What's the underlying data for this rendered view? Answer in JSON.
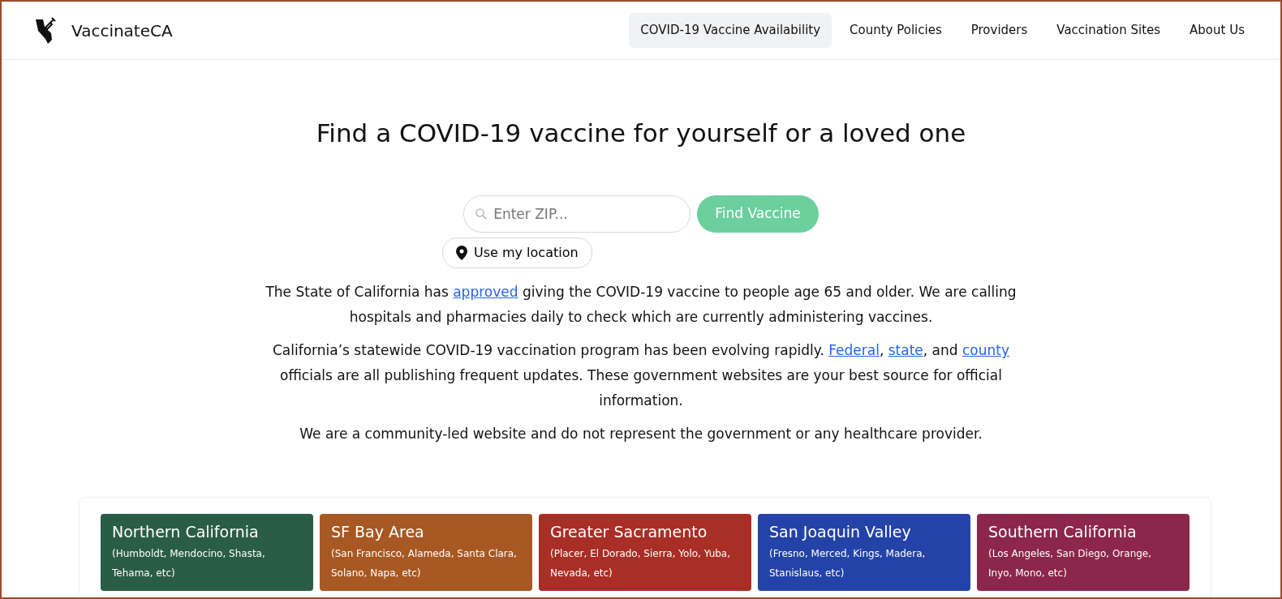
{
  "brand": {
    "name": "VaccinateCA"
  },
  "nav": [
    {
      "label": "COVID-19 Vaccine Availability",
      "selected": true
    },
    {
      "label": "County Policies",
      "selected": false
    },
    {
      "label": "Providers",
      "selected": false
    },
    {
      "label": "Vaccination Sites",
      "selected": false
    },
    {
      "label": "About Us",
      "selected": false
    }
  ],
  "heading": "Find a COVID-19 vaccine for yourself or a loved one",
  "search": {
    "placeholder": "Enter ZIP...",
    "button": "Find Vaccine",
    "location_button": "Use my location"
  },
  "paragraphs": [
    [
      {
        "text": "The State of California has "
      },
      {
        "link": "approved"
      },
      {
        "text": " giving the COVID-19 vaccine to people age 65 and older. We are calling hospitals and pharmacies daily to check which are currently administering vaccines."
      }
    ],
    [
      {
        "text": "California’s statewide COVID-19 vaccination program has been evolving rapidly. "
      },
      {
        "link": "Federal"
      },
      {
        "text": ", "
      },
      {
        "link": "state"
      },
      {
        "text": ", and "
      },
      {
        "link": "county"
      },
      {
        "text": " officials are all publishing frequent updates. These government websites are your best source for official information."
      }
    ],
    [
      {
        "text": "We are a community-led website and do not represent the government or any healthcare provider."
      }
    ]
  ],
  "regions": [
    {
      "name": "Northern California",
      "counties": "(Humboldt, Mendocino, Shasta, Tehama, etc)",
      "color": "#2a5d45"
    },
    {
      "name": "SF Bay Area",
      "counties": "(San Francisco, Alameda, Santa Clara, Solano, Napa, etc)",
      "color": "#a85823"
    },
    {
      "name": "Greater Sacramento",
      "counties": "(Placer, El Dorado, Sierra, Yolo, Yuba, Nevada, etc)",
      "color": "#a92e25"
    },
    {
      "name": "San Joaquin Valley",
      "counties": "(Fresno, Merced, Kings, Madera, Stanislaus, etc)",
      "color": "#2443a8"
    },
    {
      "name": "Southern California",
      "counties": "(Los Angeles, San Diego, Orange, Inyo, Mono, etc)",
      "color": "#8c264a"
    }
  ]
}
